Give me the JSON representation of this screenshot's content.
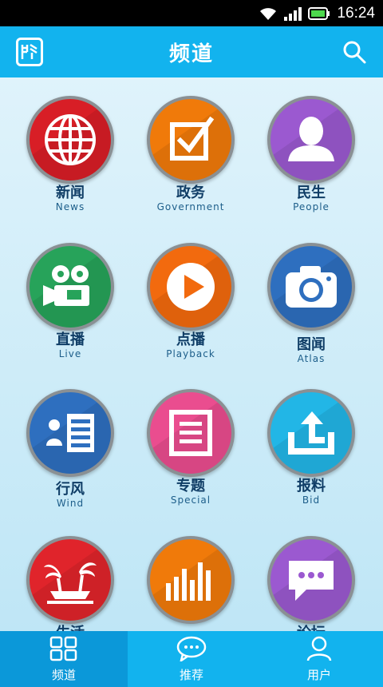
{
  "status_bar": {
    "time": "16:24"
  },
  "header": {
    "title": "频道"
  },
  "tiles": [
    {
      "cn": "新闻",
      "en": "News",
      "icon": "globe-icon",
      "color": "#d81e26"
    },
    {
      "cn": "政务",
      "en": "Government",
      "icon": "checkbox-icon",
      "color": "#f07a0a"
    },
    {
      "cn": "民生",
      "en": "People",
      "icon": "person-icon",
      "color": "#9b59d0"
    },
    {
      "cn": "直播",
      "en": "Live",
      "icon": "video-camera-icon",
      "color": "#27a35a"
    },
    {
      "cn": "点播",
      "en": "Playback",
      "icon": "play-icon",
      "color": "#f26a0e"
    },
    {
      "cn": "图闻",
      "en": "Atlas",
      "icon": "camera-icon",
      "color": "#2e6fbf"
    },
    {
      "cn": "行风",
      "en": "Wind",
      "icon": "contact-card-icon",
      "color": "#2e6fbf"
    },
    {
      "cn": "专题",
      "en": "Special",
      "icon": "document-icon",
      "color": "#ea4d8f"
    },
    {
      "cn": "报料",
      "en": "Bid",
      "icon": "upload-icon",
      "color": "#22b6e6"
    },
    {
      "cn": "生活",
      "en": "",
      "icon": "palm-tree-icon",
      "color": "#e0242b"
    },
    {
      "cn": "",
      "en": "",
      "icon": "bar-chart-icon",
      "color": "#f07a0a"
    },
    {
      "cn": "论坛",
      "en": "",
      "icon": "chat-bubble-icon",
      "color": "#9b59d0"
    }
  ],
  "tabbar": {
    "items": [
      {
        "label": "频道",
        "icon": "grid-icon",
        "active": true
      },
      {
        "label": "推荐",
        "icon": "speech-bubble-icon",
        "active": false
      },
      {
        "label": "用户",
        "icon": "user-icon",
        "active": false
      }
    ]
  }
}
